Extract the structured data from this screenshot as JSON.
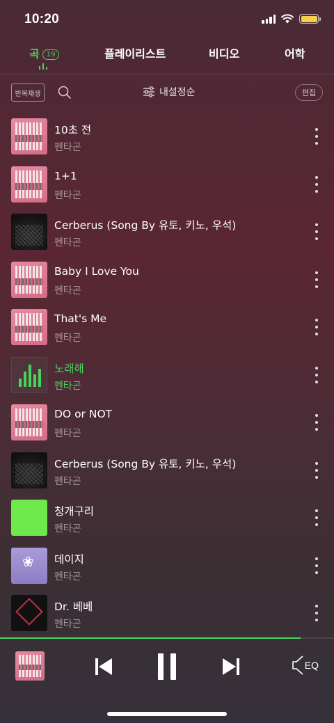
{
  "status": {
    "time": "10:20"
  },
  "tabs": {
    "songs": {
      "label": "곡",
      "count": "19"
    },
    "playlists": {
      "label": "플레이리스트"
    },
    "videos": {
      "label": "비디오"
    },
    "language": {
      "label": "어학"
    }
  },
  "toolbar": {
    "repeat_label": "반복재생",
    "sort_label": "내설정순",
    "edit_label": "편집"
  },
  "songs": [
    {
      "title": "10초 전",
      "artist": "펜타곤",
      "cover": "pink"
    },
    {
      "title": "1+1",
      "artist": "펜타곤",
      "cover": "pink"
    },
    {
      "title": "Cerberus (Song By 유토, 키노, 우석)",
      "artist": "펜타곤",
      "cover": "dark"
    },
    {
      "title": "Baby I Love You",
      "artist": "펜타곤",
      "cover": "pink"
    },
    {
      "title": "That's Me",
      "artist": "펜타곤",
      "cover": "pink"
    },
    {
      "title": "노래해",
      "artist": "펜타곤",
      "cover": "playing",
      "playing": true
    },
    {
      "title": "DO or NOT",
      "artist": "펜타곤",
      "cover": "pink"
    },
    {
      "title": "Cerberus (Song By 유토, 키노, 우석)",
      "artist": "펜타곤",
      "cover": "dark"
    },
    {
      "title": "청개구리",
      "artist": "펜타곤",
      "cover": "green"
    },
    {
      "title": "데이지",
      "artist": "펜타곤",
      "cover": "lavender"
    },
    {
      "title": "Dr. 베베",
      "artist": "펜타곤",
      "cover": "black"
    }
  ],
  "player": {
    "progress": 0.9,
    "eq_label": "EQ"
  },
  "colors": {
    "accent": "#48d45b",
    "battery": "#f7d04b"
  }
}
